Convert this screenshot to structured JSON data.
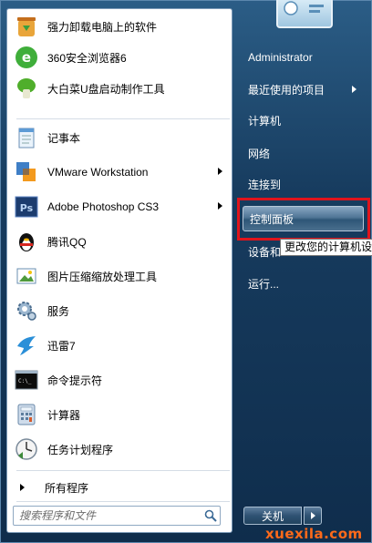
{
  "programs": [
    {
      "label": "强力卸载电脑上的软件",
      "icon": "recycle-uninstall-icon",
      "has_submenu": false
    },
    {
      "label": "360安全浏览器6",
      "icon": "360-browser-icon",
      "has_submenu": false
    },
    {
      "label": "大白菜U盘启动制作工具",
      "icon": "dabaicai-cabbage-icon",
      "has_submenu": false
    },
    {
      "label": "记事本",
      "icon": "notepad-icon",
      "has_submenu": false
    },
    {
      "label": "VMware Workstation",
      "icon": "vmware-icon",
      "has_submenu": true
    },
    {
      "label": "Adobe Photoshop CS3",
      "icon": "photoshop-icon",
      "has_submenu": true
    },
    {
      "label": "腾讯QQ",
      "icon": "qq-penguin-icon",
      "has_submenu": false
    },
    {
      "label": "图片压缩缩放处理工具",
      "icon": "image-compress-icon",
      "has_submenu": false
    },
    {
      "label": "服务",
      "icon": "services-gear-icon",
      "has_submenu": false
    },
    {
      "label": "迅雷7",
      "icon": "thunder-icon",
      "has_submenu": false
    },
    {
      "label": "命令提示符",
      "icon": "command-prompt-icon",
      "has_submenu": false
    },
    {
      "label": "计算器",
      "icon": "calculator-icon",
      "has_submenu": false
    },
    {
      "label": "任务计划程序",
      "icon": "task-scheduler-icon",
      "has_submenu": false
    }
  ],
  "all_programs": "所有程序",
  "search": {
    "placeholder": "搜索程序和文件"
  },
  "right_items": [
    {
      "label": "Administrator",
      "has_submenu": false
    },
    {
      "label": "最近使用的项目",
      "has_submenu": true
    },
    {
      "label": "计算机",
      "has_submenu": false
    },
    {
      "label": "网络",
      "has_submenu": false
    },
    {
      "label": "连接到",
      "has_submenu": false
    },
    {
      "label": "控制面板",
      "has_submenu": false,
      "highlighted": true
    },
    {
      "label": "设备和",
      "has_submenu": false
    },
    {
      "label": "运行...",
      "has_submenu": false
    }
  ],
  "tooltip": "更改您的计算机设",
  "shutdown": {
    "label": "关机"
  },
  "watermark": "xuexila.com",
  "colors": {
    "highlight_box": "#e0141c",
    "watermark": "#ff6a1a"
  }
}
